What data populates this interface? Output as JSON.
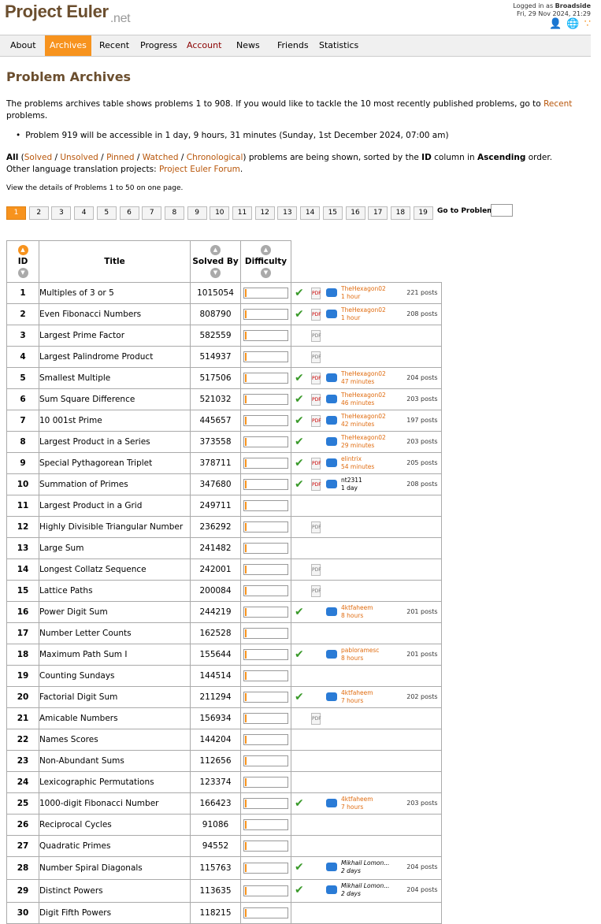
{
  "header": {
    "logo": "Project Euler",
    "logo_suffix": ".net",
    "logged_in_prefix": "Logged in as",
    "username": "Broadside",
    "datetime": "Fri, 29 Nov 2024, 21:29",
    "icons": [
      "add-friend-icon",
      "globe-icon",
      "rss-icon"
    ]
  },
  "nav": {
    "items": [
      "About",
      "Archives",
      "Recent",
      "Progress",
      "Account",
      "News",
      "Friends",
      "Statistics"
    ],
    "active": "Archives"
  },
  "page_title": "Problem Archives",
  "intro": {
    "text": "The problems archives table shows problems 1 to 908. If you would like to tackle the 10 most recently published problems, go to",
    "link": "Recent",
    "tail": "problems."
  },
  "notice": "Problem 919 will be accessible in 1 day, 9 hours, 31 minutes (Sunday, 1st December 2024, 07:00 am)",
  "filters": {
    "all": "All",
    "options": [
      "Solved",
      "Unsolved",
      "Pinned",
      "Watched",
      "Chronological"
    ],
    "text_mid": "problems are being shown, sorted by the",
    "sort_col": "ID",
    "text_mid2": "column in",
    "sort_dir": "Ascending",
    "text_end": "order.",
    "translation_text": "Other language translation projects:",
    "translation_link": "Project Euler Forum"
  },
  "details_text": "View the details of Problems 1 to 50 on one page.",
  "pagination": {
    "pages": [
      "1",
      "2",
      "3",
      "4",
      "5",
      "6",
      "7",
      "8",
      "9",
      "10",
      "11",
      "12",
      "13",
      "14",
      "15",
      "16",
      "17",
      "18",
      "19"
    ],
    "active": "1",
    "goto_label": "Go to Problem:"
  },
  "table": {
    "headers": {
      "id": "ID",
      "title": "Title",
      "solved": "Solved By",
      "difficulty": "Difficulty"
    },
    "rows": [
      {
        "id": "1",
        "title": "Multiples of 3 or 5",
        "solved": "1015054",
        "solved_me": true,
        "pdf": "red",
        "chat": true,
        "user": "TheHexagon02",
        "ago": "1 hour",
        "posts": "221 posts"
      },
      {
        "id": "2",
        "title": "Even Fibonacci Numbers",
        "solved": "808790",
        "solved_me": true,
        "pdf": "red",
        "chat": true,
        "user": "TheHexagon02",
        "ago": "1 hour",
        "posts": "208 posts"
      },
      {
        "id": "3",
        "title": "Largest Prime Factor",
        "solved": "582559",
        "solved_me": false,
        "pdf": "grey",
        "chat": false,
        "user": "",
        "ago": "",
        "posts": ""
      },
      {
        "id": "4",
        "title": "Largest Palindrome Product",
        "solved": "514937",
        "solved_me": false,
        "pdf": "grey",
        "chat": false,
        "user": "",
        "ago": "",
        "posts": ""
      },
      {
        "id": "5",
        "title": "Smallest Multiple",
        "solved": "517506",
        "solved_me": true,
        "pdf": "red",
        "chat": true,
        "user": "TheHexagon02",
        "ago": "47 minutes",
        "posts": "204 posts"
      },
      {
        "id": "6",
        "title": "Sum Square Difference",
        "solved": "521032",
        "solved_me": true,
        "pdf": "red",
        "chat": true,
        "user": "TheHexagon02",
        "ago": "46 minutes",
        "posts": "203 posts"
      },
      {
        "id": "7",
        "title": "10 001st Prime",
        "solved": "445657",
        "solved_me": true,
        "pdf": "red",
        "chat": true,
        "user": "TheHexagon02",
        "ago": "42 minutes",
        "posts": "197 posts"
      },
      {
        "id": "8",
        "title": "Largest Product in a Series",
        "solved": "373558",
        "solved_me": true,
        "pdf": "",
        "chat": true,
        "user": "TheHexagon02",
        "ago": "29 minutes",
        "posts": "203 posts"
      },
      {
        "id": "9",
        "title": "Special Pythagorean Triplet",
        "solved": "378711",
        "solved_me": true,
        "pdf": "red",
        "chat": true,
        "user": "elintrix",
        "ago": "54 minutes",
        "posts": "205 posts"
      },
      {
        "id": "10",
        "title": "Summation of Primes",
        "solved": "347680",
        "solved_me": true,
        "pdf": "red",
        "chat": true,
        "user": "nt2311",
        "ago": "1 day",
        "posts": "208 posts",
        "dark": true
      },
      {
        "id": "11",
        "title": "Largest Product in a Grid",
        "solved": "249711",
        "solved_me": false,
        "pdf": "",
        "chat": false,
        "user": "",
        "ago": "",
        "posts": ""
      },
      {
        "id": "12",
        "title": "Highly Divisible Triangular Number",
        "solved": "236292",
        "solved_me": false,
        "pdf": "grey",
        "chat": false,
        "user": "",
        "ago": "",
        "posts": ""
      },
      {
        "id": "13",
        "title": "Large Sum",
        "solved": "241482",
        "solved_me": false,
        "pdf": "",
        "chat": false,
        "user": "",
        "ago": "",
        "posts": ""
      },
      {
        "id": "14",
        "title": "Longest Collatz Sequence",
        "solved": "242001",
        "solved_me": false,
        "pdf": "grey",
        "chat": false,
        "user": "",
        "ago": "",
        "posts": ""
      },
      {
        "id": "15",
        "title": "Lattice Paths",
        "solved": "200084",
        "solved_me": false,
        "pdf": "grey",
        "chat": false,
        "user": "",
        "ago": "",
        "posts": ""
      },
      {
        "id": "16",
        "title": "Power Digit Sum",
        "solved": "244219",
        "solved_me": true,
        "pdf": "",
        "chat": true,
        "user": "4ktfaheem",
        "ago": "8 hours",
        "posts": "201 posts"
      },
      {
        "id": "17",
        "title": "Number Letter Counts",
        "solved": "162528",
        "solved_me": false,
        "pdf": "",
        "chat": false,
        "user": "",
        "ago": "",
        "posts": ""
      },
      {
        "id": "18",
        "title": "Maximum Path Sum I",
        "solved": "155644",
        "solved_me": true,
        "pdf": "",
        "chat": true,
        "user": "pabloramesc",
        "ago": "8 hours",
        "posts": "201 posts"
      },
      {
        "id": "19",
        "title": "Counting Sundays",
        "solved": "144514",
        "solved_me": false,
        "pdf": "",
        "chat": false,
        "user": "",
        "ago": "",
        "posts": ""
      },
      {
        "id": "20",
        "title": "Factorial Digit Sum",
        "solved": "211294",
        "solved_me": true,
        "pdf": "",
        "chat": true,
        "user": "4ktfaheem",
        "ago": "7 hours",
        "posts": "202 posts"
      },
      {
        "id": "21",
        "title": "Amicable Numbers",
        "solved": "156934",
        "solved_me": false,
        "pdf": "grey",
        "chat": false,
        "user": "",
        "ago": "",
        "posts": ""
      },
      {
        "id": "22",
        "title": "Names Scores",
        "solved": "144204",
        "solved_me": false,
        "pdf": "",
        "chat": false,
        "user": "",
        "ago": "",
        "posts": ""
      },
      {
        "id": "23",
        "title": "Non-Abundant Sums",
        "solved": "112656",
        "solved_me": false,
        "pdf": "",
        "chat": false,
        "user": "",
        "ago": "",
        "posts": ""
      },
      {
        "id": "24",
        "title": "Lexicographic Permutations",
        "solved": "123374",
        "solved_me": false,
        "pdf": "",
        "chat": false,
        "user": "",
        "ago": "",
        "posts": ""
      },
      {
        "id": "25",
        "title": "1000-digit Fibonacci Number",
        "solved": "166423",
        "solved_me": true,
        "pdf": "",
        "chat": true,
        "user": "4ktfaheem",
        "ago": "7 hours",
        "posts": "203 posts"
      },
      {
        "id": "26",
        "title": "Reciprocal Cycles",
        "solved": "91086",
        "solved_me": false,
        "pdf": "",
        "chat": false,
        "user": "",
        "ago": "",
        "posts": ""
      },
      {
        "id": "27",
        "title": "Quadratic Primes",
        "solved": "94552",
        "solved_me": false,
        "pdf": "",
        "chat": false,
        "user": "",
        "ago": "",
        "posts": ""
      },
      {
        "id": "28",
        "title": "Number Spiral Diagonals",
        "solved": "115763",
        "solved_me": true,
        "pdf": "",
        "chat": true,
        "user": "Mikhail Lomon...",
        "ago": "2 days",
        "posts": "204 posts",
        "ital": true
      },
      {
        "id": "29",
        "title": "Distinct Powers",
        "solved": "113635",
        "solved_me": true,
        "pdf": "",
        "chat": true,
        "user": "Mikhail Lomon...",
        "ago": "2 days",
        "posts": "204 posts",
        "ital": true
      },
      {
        "id": "30",
        "title": "Digit Fifth Powers",
        "solved": "118215",
        "solved_me": false,
        "pdf": "",
        "chat": false,
        "user": "",
        "ago": "",
        "posts": ""
      }
    ]
  },
  "colors": {
    "accent": "#f7931e",
    "brand": "#6b4e2e",
    "link": "#b8560a",
    "solved": "#3a9a2a",
    "forum": "#2a7bd6"
  }
}
